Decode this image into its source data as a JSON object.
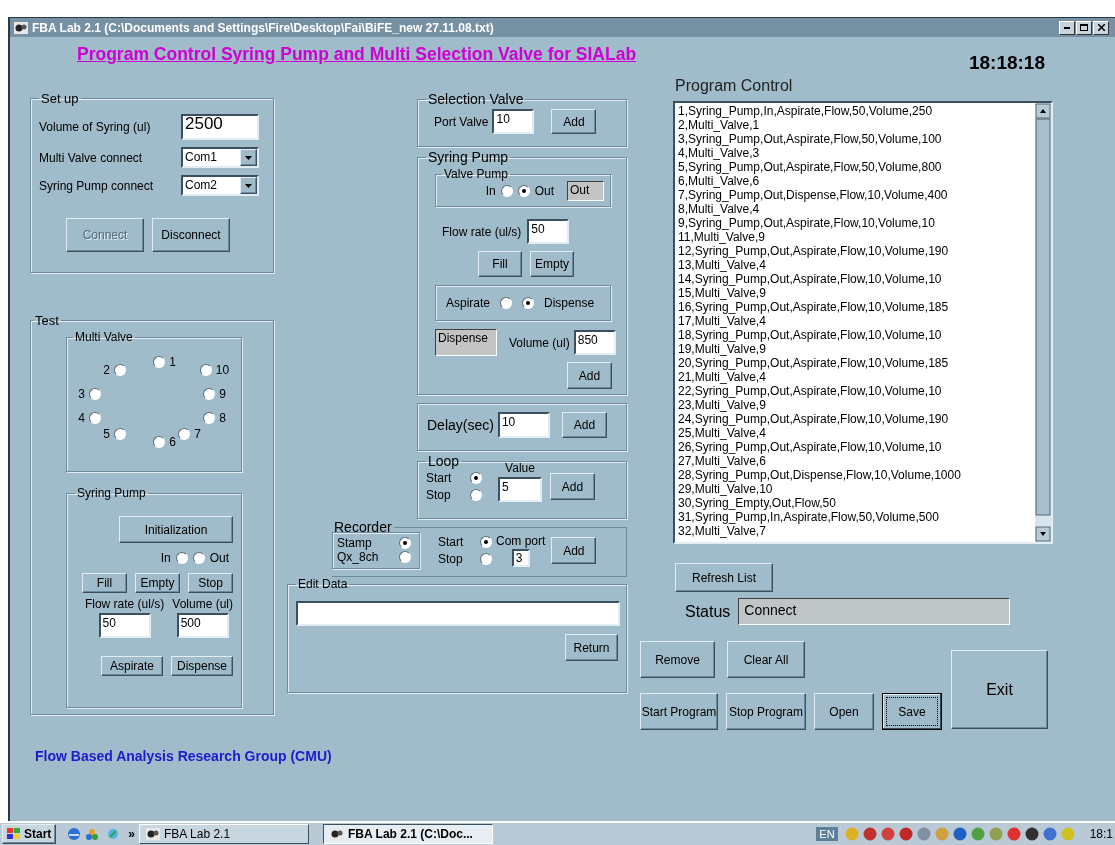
{
  "window": {
    "title": "FBA Lab 2.1 (C:\\Documents and Settings\\Fire\\Desktop\\Fai\\BiFE_new 27.11.08.txt)"
  },
  "heading": "Program Control Syring Pump and Multi Selection Valve for SIALab",
  "clock": "18:18:18",
  "setup": {
    "title": "Set up",
    "fields": [
      {
        "label": "Volume of Syring (ul)",
        "value": "2500",
        "kind": "text"
      },
      {
        "label": "Multi Valve connect",
        "value": "Com1",
        "kind": "dropdown"
      },
      {
        "label": "Syring Pump connect",
        "value": "Com2",
        "kind": "dropdown"
      }
    ],
    "buttons": [
      {
        "label": "Connect",
        "disabled": true
      },
      {
        "label": "Disconnect",
        "disabled": false
      }
    ]
  },
  "test": {
    "title": "Test",
    "multi_valve": {
      "title": "Multi Valve",
      "ports": [
        {
          "label": "2",
          "selected": false
        },
        {
          "label": "1",
          "selected": false
        },
        {
          "label": "10",
          "selected": false
        },
        {
          "label": "3",
          "selected": false
        },
        {
          "label": "9",
          "selected": false
        },
        {
          "label": "4",
          "selected": false
        },
        {
          "label": "8",
          "selected": false
        },
        {
          "label": "5",
          "selected": false
        },
        {
          "label": "6",
          "selected": false
        },
        {
          "label": "7",
          "selected": false
        }
      ]
    },
    "syring_pump": {
      "title": "Syring Pump",
      "init_button": "Initialization",
      "direction": [
        {
          "label": "In",
          "selected": false
        },
        {
          "label": "Out",
          "selected": false
        }
      ],
      "buttons": [
        "Fill",
        "Empty",
        "Stop"
      ],
      "flow_rate": {
        "label": "Flow rate (ul/s)",
        "value": "50"
      },
      "volume": {
        "label": "Volume (ul)",
        "value": "500"
      },
      "actions": [
        "Aspirate",
        "Dispense"
      ]
    }
  },
  "selection_valve": {
    "title": "Selection Valve",
    "label": "Port Valve",
    "value": "10",
    "button": "Add"
  },
  "pump": {
    "title": "Syring Pump",
    "valve_pump": {
      "title": "Valve Pump",
      "options": [
        {
          "label": "In",
          "selected": false
        },
        {
          "label": "Out",
          "selected": true
        }
      ],
      "display": "Out"
    },
    "flow_rate": {
      "label": "Flow rate (ul/s)",
      "value": "50"
    },
    "buttons": [
      "Fill",
      "Empty"
    ],
    "modes": [
      {
        "label": "Aspirate",
        "selected": false
      },
      {
        "label": "Dispense",
        "selected": true
      }
    ],
    "mode_display": "Dispense",
    "volume": {
      "label": "Volume (ul)",
      "value": "850"
    },
    "button": "Add"
  },
  "delay": {
    "label": "Delay(sec)",
    "value": "10",
    "button": "Add"
  },
  "loop": {
    "title": "Loop",
    "options": [
      {
        "label": "Start",
        "selected": true
      },
      {
        "label": "Stop",
        "selected": false
      }
    ],
    "value_label": "Value",
    "value": "5",
    "button": "Add"
  },
  "recorder": {
    "title": "Recorder",
    "devices": [
      {
        "label": "Stamp",
        "selected": true
      },
      {
        "label": "Qx_8ch",
        "selected": false
      }
    ],
    "options": [
      {
        "label": "Start",
        "selected": true
      },
      {
        "label": "Stop",
        "selected": false
      }
    ],
    "port_label": "Com port",
    "port": "3",
    "button": "Add"
  },
  "edit_data": {
    "title": "Edit Data",
    "button": "Return"
  },
  "program": {
    "title": "Program Control",
    "items": [
      "1,Syring_Pump,In,Aspirate,Flow,50,Volume,250",
      "2,Multi_Valve,1",
      "3,Syring_Pump,Out,Aspirate,Flow,50,Volume,100",
      "4,Multi_Valve,3",
      "5,Syring_Pump,Out,Aspirate,Flow,50,Volume,800",
      "6,Multi_Valve,6",
      "7,Syring_Pump,Out,Dispense,Flow,10,Volume,400",
      "8,Multi_Valve,4",
      "9,Syring_Pump,Out,Aspirate,Flow,10,Volume,10",
      "11,Multi_Valve,9",
      "12,Syring_Pump,Out,Aspirate,Flow,10,Volume,190",
      "13,Multi_Valve,4",
      "14,Syring_Pump,Out,Aspirate,Flow,10,Volume,10",
      "15,Multi_Valve,9",
      "16,Syring_Pump,Out,Aspirate,Flow,10,Volume,185",
      "17,Multi_Valve,4",
      "18,Syring_Pump,Out,Aspirate,Flow,10,Volume,10",
      "19,Multi_Valve,9",
      "20,Syring_Pump,Out,Aspirate,Flow,10,Volume,185",
      "21,Multi_Valve,4",
      "22,Syring_Pump,Out,Aspirate,Flow,10,Volume,10",
      "23,Multi_Valve,9",
      "24,Syring_Pump,Out,Aspirate,Flow,10,Volume,190",
      "25,Multi_Valve,4",
      "26,Syring_Pump,Out,Aspirate,Flow,10,Volume,10",
      "27,Multi_Valve,6",
      "28,Syring_Pump,Out,Dispense,Flow,10,Volume,1000",
      "29,Multi_Valve,10",
      "30,Syring_Empty,Out,Flow,50",
      "31,Syring_Pump,In,Aspirate,Flow,50,Volume,500",
      "32,Multi_Valve,7"
    ]
  },
  "refresh_button": "Refresh List",
  "status": {
    "label": "Status",
    "value": "Connect"
  },
  "edit_buttons": [
    {
      "label": "Remove",
      "focused": false
    },
    {
      "label": "Clear All",
      "focused": false
    }
  ],
  "exit_button": "Exit",
  "program_buttons": [
    {
      "label": "Start Program",
      "focused": false
    },
    {
      "label": "Stop Program",
      "focused": false
    },
    {
      "label": "Open",
      "focused": false
    },
    {
      "label": "Save",
      "focused": true
    }
  ],
  "footer": "Flow Based Analysis Research Group (CMU)",
  "taskbar": {
    "start": "Start",
    "more": "»",
    "tasks": [
      {
        "label": "FBA Lab 2.1",
        "selected": false
      },
      {
        "label": "FBA Lab 2.1 (C:\\Doc...",
        "selected": true
      }
    ],
    "language": "EN",
    "clock": "18:1"
  }
}
